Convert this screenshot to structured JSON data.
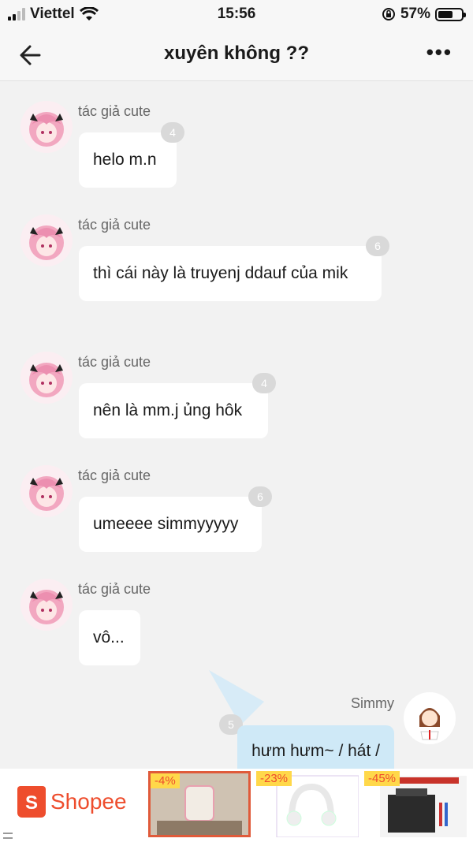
{
  "status_bar": {
    "carrier": "Viettel",
    "time": "15:56",
    "battery_percent": "57%"
  },
  "header": {
    "title": "xuyên không ??"
  },
  "messages": [
    {
      "sender": "tác giả cute",
      "text": "helo m.n",
      "badge": "4"
    },
    {
      "sender": "tác giả cute",
      "text": "thì cái này là truyenj ddauf của mik",
      "badge": "6"
    },
    {
      "sender": "tác giả cute",
      "text": "nên là mm.j ủng hôk",
      "badge": "4"
    },
    {
      "sender": "tác giả cute",
      "text": "umeeee simmyyyyy",
      "badge": "6"
    },
    {
      "sender": "tác giả cute",
      "text": "vô...",
      "badge": ""
    }
  ],
  "my_message": {
    "sender": "Simmy",
    "text": "hưm hưm~ / hát /",
    "badge": "5"
  },
  "ad": {
    "brand": "Shopee",
    "products": [
      {
        "discount": "-4%"
      },
      {
        "discount": "-23%"
      },
      {
        "discount": "-45%"
      }
    ]
  },
  "colors": {
    "brand": "#ee4d2d",
    "bubble": "#ffffff",
    "my_bubble": "#cfe9f7",
    "background": "#f2f2f2"
  }
}
